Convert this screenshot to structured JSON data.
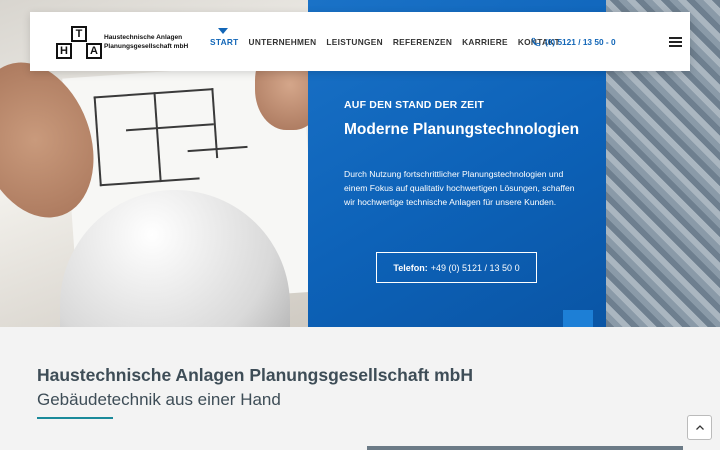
{
  "header": {
    "logo": {
      "letters": [
        "H",
        "T",
        "A"
      ],
      "line1": "Haustechnische Anlagen",
      "line2": "Planungsgesellschaft mbH"
    },
    "nav": [
      {
        "label": "START",
        "active": true
      },
      {
        "label": "UNTERNEHMEN"
      },
      {
        "label": "LEISTUNGEN"
      },
      {
        "label": "REFERENZEN"
      },
      {
        "label": "KARRIERE"
      },
      {
        "label": "KONTAKT"
      }
    ],
    "phone": "(0) 5121 / 13 50 - 0",
    "phone_icon": "phone-icon",
    "menu_icon": "hamburger-icon"
  },
  "hero": {
    "eyebrow": "AUF DEN STAND DER ZEIT",
    "title": "Moderne Planungstechnologien",
    "text": "Durch Nutzung fortschrittlicher Planungstechnologien und einem Fokus auf qualitativ hochwertigen Lösungen, schaffen wir hochwertige technische Anlagen für unsere Kunden.",
    "button_label": "Telefon:",
    "button_number": "+49 (0) 5121 / 13 50 0"
  },
  "content": {
    "company": "Haustechnische Anlagen Planungsgesellschaft mbH",
    "subline": "Gebäudetechnik aus einer Hand"
  },
  "colors": {
    "accent": "#1266b7",
    "panel": "#0d62b8",
    "underline": "#1a8a9a"
  }
}
